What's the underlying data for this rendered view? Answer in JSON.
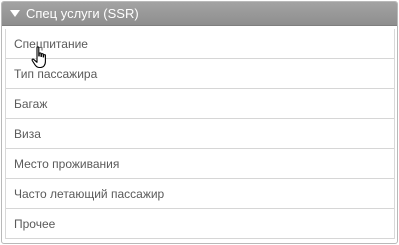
{
  "panel": {
    "title": "Спец услуги (SSR)",
    "collapse_icon": "triangle-down-icon"
  },
  "items": [
    {
      "label": "Спецпитание"
    },
    {
      "label": "Тип пассажира"
    },
    {
      "label": "Багаж"
    },
    {
      "label": "Виза"
    },
    {
      "label": "Место проживания"
    },
    {
      "label": "Часто летающий пассажир"
    },
    {
      "label": "Прочее"
    }
  ],
  "colors": {
    "header_bg": "#999999",
    "header_text": "#ffffff",
    "item_text": "#5a5a5a",
    "divider": "#d6d6d6"
  },
  "cursor": "hand-pointer-icon"
}
